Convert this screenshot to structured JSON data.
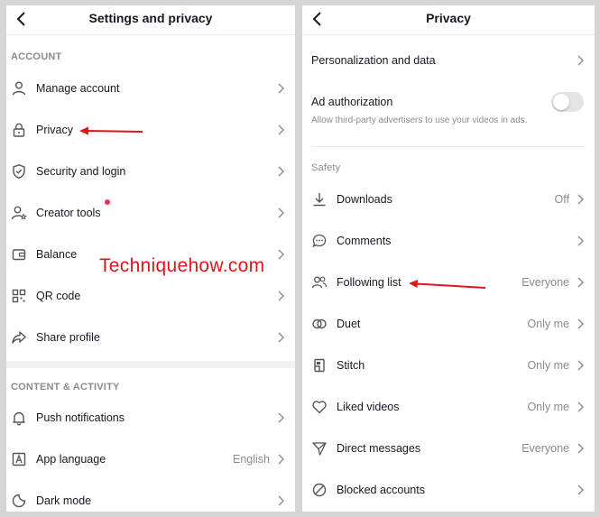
{
  "colors": {
    "accent": "#fe2c55",
    "arrow": "#e2141c",
    "muted": "#8a8b91",
    "text": "#161823"
  },
  "left": {
    "title": "Settings and privacy",
    "back_icon": "chevron-left-icon",
    "section_account": "ACCOUNT",
    "items": [
      {
        "label": "Manage account",
        "icon": "person-icon"
      },
      {
        "label": "Privacy",
        "icon": "lock-icon"
      },
      {
        "label": "Security and login",
        "icon": "shield-icon"
      },
      {
        "label": "Creator tools",
        "icon": "person-star-icon"
      },
      {
        "label": "Balance",
        "icon": "wallet-icon"
      },
      {
        "label": "QR code",
        "icon": "qr-code-icon"
      },
      {
        "label": "Share profile",
        "icon": "share-icon"
      }
    ],
    "section_content": "CONTENT & ACTIVITY",
    "content_items": [
      {
        "label": "Push notifications",
        "icon": "bell-icon",
        "value": ""
      },
      {
        "label": "App language",
        "icon": "language-icon",
        "value": "English"
      },
      {
        "label": "Dark mode",
        "icon": "dark-mode-icon",
        "value": ""
      }
    ]
  },
  "right": {
    "title": "Privacy",
    "back_icon": "chevron-left-icon",
    "personalization": "Personalization and data",
    "ad_auth": {
      "label": "Ad authorization",
      "sub": "Allow third-party advertisers to use your videos in ads.",
      "enabled": false
    },
    "section_safety": "Safety",
    "items": [
      {
        "label": "Downloads",
        "icon": "download-icon",
        "value": "Off"
      },
      {
        "label": "Comments",
        "icon": "comment-icon",
        "value": ""
      },
      {
        "label": "Following list",
        "icon": "people-icon",
        "value": "Everyone"
      },
      {
        "label": "Duet",
        "icon": "duet-icon",
        "value": "Only me"
      },
      {
        "label": "Stitch",
        "icon": "stitch-icon",
        "value": "Only me"
      },
      {
        "label": "Liked videos",
        "icon": "heart-icon",
        "value": "Only me"
      },
      {
        "label": "Direct messages",
        "icon": "send-icon",
        "value": "Everyone"
      },
      {
        "label": "Blocked accounts",
        "icon": "block-icon",
        "value": ""
      }
    ]
  },
  "watermark": "Techniquehow.com"
}
